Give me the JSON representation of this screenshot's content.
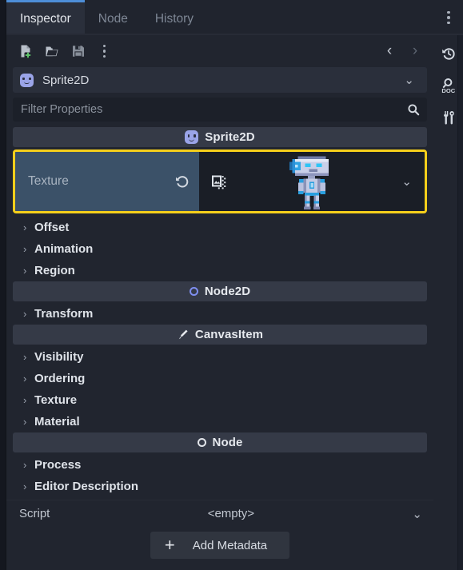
{
  "window": {
    "title": "Inspector"
  },
  "tabs": [
    {
      "label": "Inspector",
      "active": true
    },
    {
      "label": "Node",
      "active": false
    },
    {
      "label": "History",
      "active": false
    }
  ],
  "tab_menu": {
    "icon": "vertical-dots-icon"
  },
  "toolbar": {
    "new_resource": "new-resource-icon",
    "open_resource": "open-folder-icon",
    "save_resource": "save-floppy-icon",
    "extra_menu": "vertical-dots-icon",
    "back": "‹",
    "forward": "›",
    "history": "history-revert-icon"
  },
  "object_selector": {
    "label": "Sprite2D",
    "icon": "sprite2d-icon",
    "chevron": "⌄"
  },
  "side_icons": [
    {
      "name": "open-documentation-icon",
      "label": "DOC"
    },
    {
      "name": "object-tools-icon",
      "label": ""
    }
  ],
  "search": {
    "placeholder": "Filter Properties",
    "value": "",
    "icon": "search-icon",
    "tools_icon": "property-tools-icon"
  },
  "sections": [
    {
      "title": "Sprite2D",
      "icon": "sprite2d-icon",
      "rows": [
        "Offset",
        "Animation",
        "Region"
      ]
    },
    {
      "title": "Node2D",
      "icon": "node2d-circle-icon",
      "rows": [
        "Transform"
      ]
    },
    {
      "title": "CanvasItem",
      "icon": "canvasitem-brush-icon",
      "rows": [
        "Visibility",
        "Ordering",
        "Texture",
        "Material"
      ]
    },
    {
      "title": "Node",
      "icon": "node-circle-icon",
      "rows": [
        "Process",
        "Editor Description"
      ]
    }
  ],
  "texture_property": {
    "label": "Texture",
    "revert_icon": "revert-arrow-icon",
    "quick_load_icon": "quick-load-texture-icon",
    "thumbnail_name": "robot-sprite-thumbnail",
    "chevron": "⌄",
    "highlight_color": "#f5cf1b"
  },
  "script_row": {
    "label": "Script",
    "value": "<empty>",
    "chevron": "⌄"
  },
  "add_metadata": {
    "label": "Add Metadata",
    "plus": "+"
  },
  "colors": {
    "background": "#21252f",
    "section_header": "#353a47",
    "highlight": "#f5cf1b",
    "accent_tab": "#4d8ed8",
    "selected_property": "#3b5168"
  },
  "expand_arrow": "›"
}
